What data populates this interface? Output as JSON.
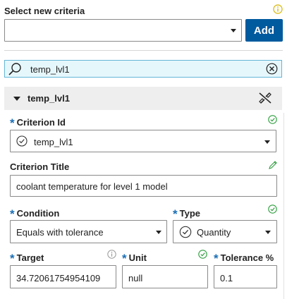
{
  "criteria_selector": {
    "label": "Select new criteria",
    "value": "",
    "add_button": "Add",
    "info_icon": "info-icon"
  },
  "search": {
    "value": "temp_lvl1",
    "search_icon": "search-icon",
    "clear_icon": "clear-circle-icon"
  },
  "section": {
    "title": "temp_lvl1",
    "collapse_icon": "triangle-down-icon",
    "action_icon": "disconnect-icon"
  },
  "criterion_id": {
    "label": "Criterion Id",
    "value": "temp_lvl1",
    "status_icon": "check-circle-icon"
  },
  "criterion_title": {
    "label": "Criterion Title",
    "value": "coolant temperature for level 1 model",
    "edit_icon": "pencil-icon"
  },
  "condition": {
    "label": "Condition",
    "value": "Equals with tolerance"
  },
  "type": {
    "label": "Type",
    "value": "Quantity",
    "status_icon": "check-circle-icon"
  },
  "target": {
    "label": "Target",
    "value": "34.72061754954109",
    "info_icon": "info-icon"
  },
  "unit": {
    "label": "Unit",
    "value": "null",
    "status_icon": "check-circle-icon"
  },
  "tolerance": {
    "label": "Tolerance %",
    "value": "0.1"
  },
  "colors": {
    "accent": "#005a9e",
    "required": "#1b6fb5",
    "success": "#2e9e3e",
    "warning_icon": "#d7b400",
    "search_bg": "#e6f7fb",
    "search_border": "#64b6d6",
    "section_bg": "#eeeeee"
  }
}
